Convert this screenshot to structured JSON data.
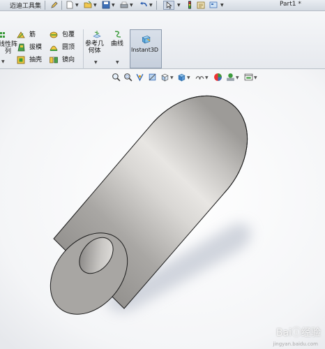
{
  "titlebar": {
    "toolbar_name": "迈迪工具集",
    "document_name": "Part1 *",
    "icons": [
      "pencil-icon",
      "new-document-icon",
      "open-folder-icon",
      "save-icon",
      "print-icon",
      "undo-icon",
      "select-pointer-icon",
      "traffic-light-icon",
      "options-icon",
      "screen-icon"
    ]
  },
  "ribbon": {
    "linear_pattern": "线性阵\n列",
    "rib": "筋",
    "draft": "拔模",
    "shell": "抽壳",
    "wrap": "包覆",
    "dome": "圆顶",
    "mirror": "镜向",
    "ref_geometry": "参考几\n何体",
    "curves": "曲线",
    "instant3d": "Instant3D"
  },
  "hud_icons": [
    "zoom-to-fit-icon",
    "zoom-area-icon",
    "previous-view-icon",
    "section-view-icon",
    "view-orientation-icon",
    "display-style-icon",
    "hide-show-items-icon",
    "edit-appearance-icon",
    "apply-scene-icon",
    "view-settings-icon"
  ],
  "model": {
    "shape": "hollow-cylinder",
    "colors": {
      "body_light": "#e6e4e1",
      "body_mid": "#b9b7b4",
      "body_dark": "#8f8d8a",
      "face": "#a9a7a4",
      "shadow": "#c9ced8",
      "edge": "#1a1a1a"
    }
  },
  "watermark": {
    "text": "Bai&#x24D8;经验",
    "sub": "jingyan.baidu.com"
  }
}
